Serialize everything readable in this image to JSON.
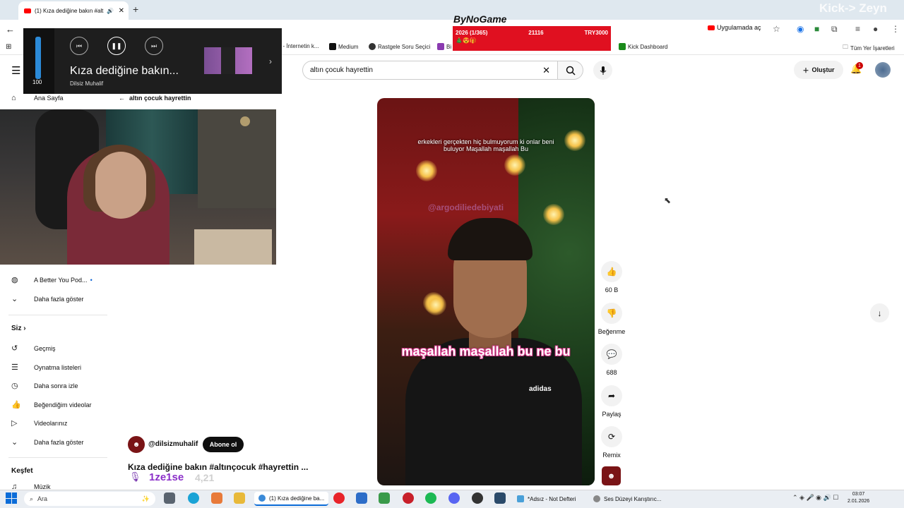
{
  "browser": {
    "tab_title": "(1) Kıza dediğine bakın #alt",
    "new_tab": "+",
    "open_in_app": "Uygulamada aç",
    "bookmarks": [
      "t - İnternetin k...",
      "Medium",
      "Rastgele Soru Seçici",
      "Bi",
      "Kick Dashboard",
      "Tüm Yer İşaretleri"
    ]
  },
  "overlay": {
    "kick_watermark": "Kick-> Zeyn",
    "bynogame_logo": "ByNoGame",
    "bynogame_progress": "2026 (1/365)",
    "bynogame_count": "21116",
    "bynogame_amount": "TRY3000",
    "bynogame_emoji": "🎄😍🎁"
  },
  "media": {
    "volume": "100",
    "volume_level": 1.0,
    "title": "Kıza dediğine bakın...",
    "artist": "Dilsiz Muhalif"
  },
  "header": {
    "search_value": "altın çocuk hayrettin",
    "create_label": "Oluştur",
    "notification_count": "1"
  },
  "sidebar": {
    "home": "Ana Sayfa",
    "sub_item": "A Better You Pod...",
    "show_more_1": "Daha fazla göster",
    "you_section": "Siz",
    "items": [
      "Geçmiş",
      "Oynatma listeleri",
      "Daha sonra izle",
      "Beğendiğim videolar",
      "Videolarınız"
    ],
    "show_more_2": "Daha fazla göster",
    "explore_section": "Keşfet",
    "music": "Müzik"
  },
  "main": {
    "back_query": "altın çocuk hayrettin",
    "caption_top": "erkekleri gerçekten hiç bulmuyorum ki onlar beni buluyor Maşallah maşallah Bu",
    "watermark": "@argodiliedebiyati",
    "caption_big": "maşallah maşallah bu ne bu",
    "shirt_brand": "adidas",
    "channel": "@dilsizmuhalif",
    "subscribe": "Abone ol",
    "video_title": "Kıza dediğine bakın #altınçocuk #hayrettin ...",
    "kick_tag": "1ze1se",
    "kick_tag_faded": "4,21"
  },
  "actions": {
    "like_count": "60 B",
    "dislike_label": "Beğenme",
    "comments": "688",
    "share": "Paylaş",
    "remix": "Remix"
  },
  "taskbar": {
    "search": "Ara",
    "apps": [
      "(1) Kıza dediğine ba...",
      "*Adsız - Not Defteri",
      "Ses Düzeyi Karıştırıc..."
    ],
    "time": "03:07",
    "date": "2.01.2026"
  }
}
